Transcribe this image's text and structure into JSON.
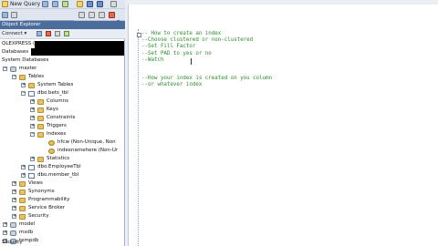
{
  "toolbar": {
    "new_query_label": "New Query",
    "database_value": "master",
    "execute_label": "E"
  },
  "object_explorer": {
    "title": "Object Explorer",
    "connect_label": "Connect ▾",
    "server_label": "QLEXPRESS (S",
    "tree": [
      {
        "label": "Databases"
      },
      {
        "label": "System Databases"
      },
      {
        "label": "master"
      },
      {
        "label": "Tables"
      },
      {
        "label": "System Tables"
      },
      {
        "label": "dbo.bets_tbl"
      },
      {
        "label": "Columns"
      },
      {
        "label": "Keys"
      },
      {
        "label": "Constraints"
      },
      {
        "label": "Triggers"
      },
      {
        "label": "Indexes"
      },
      {
        "label": "hfcw (Non-Unique, Non"
      },
      {
        "label": "indexnamehere (Non-Ur"
      },
      {
        "label": "Statistics"
      },
      {
        "label": "dbo.EmployeeTbl"
      },
      {
        "label": "dbo.member_tbl"
      },
      {
        "label": "Views"
      },
      {
        "label": "Synonyms"
      },
      {
        "label": "Programmability"
      },
      {
        "label": "Service Broker"
      },
      {
        "label": "Security"
      },
      {
        "label": "model"
      },
      {
        "label": "msdb"
      },
      {
        "label": "tempdb"
      },
      {
        "label": "Security"
      }
    ]
  },
  "editor": {
    "lines": [
      "-- How to create an index",
      "--Choose clustered or non-clustered",
      "--Set Fill Factor",
      "--Set PAD to yes or no",
      "--Watch",
      "",
      "--How your index is created on you column",
      "--or whatever index"
    ]
  },
  "colors": {
    "comment": "#2e8b2e",
    "panel_header": "#4c6d9c",
    "toolbar_bg": "#dfe6f0"
  }
}
